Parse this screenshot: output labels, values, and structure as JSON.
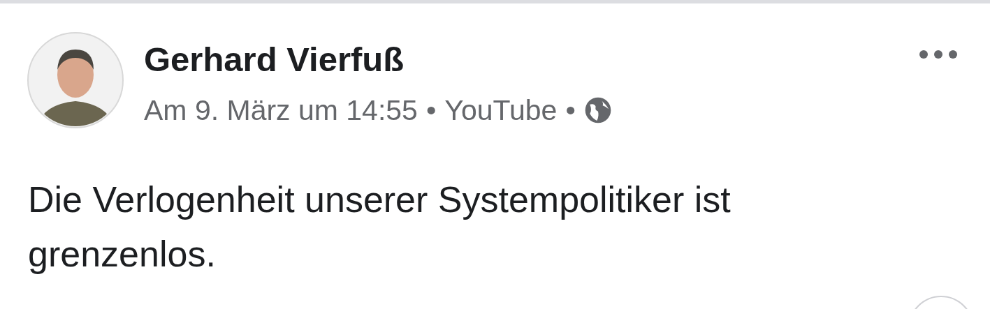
{
  "post": {
    "author": "Gerhard Vierfuß",
    "meta": [
      "Am 9. März um 14:55",
      "•",
      "YouTube",
      "•"
    ],
    "text": "Die Verlogenheit unserer Systempolitiker ist grenzenlos."
  }
}
